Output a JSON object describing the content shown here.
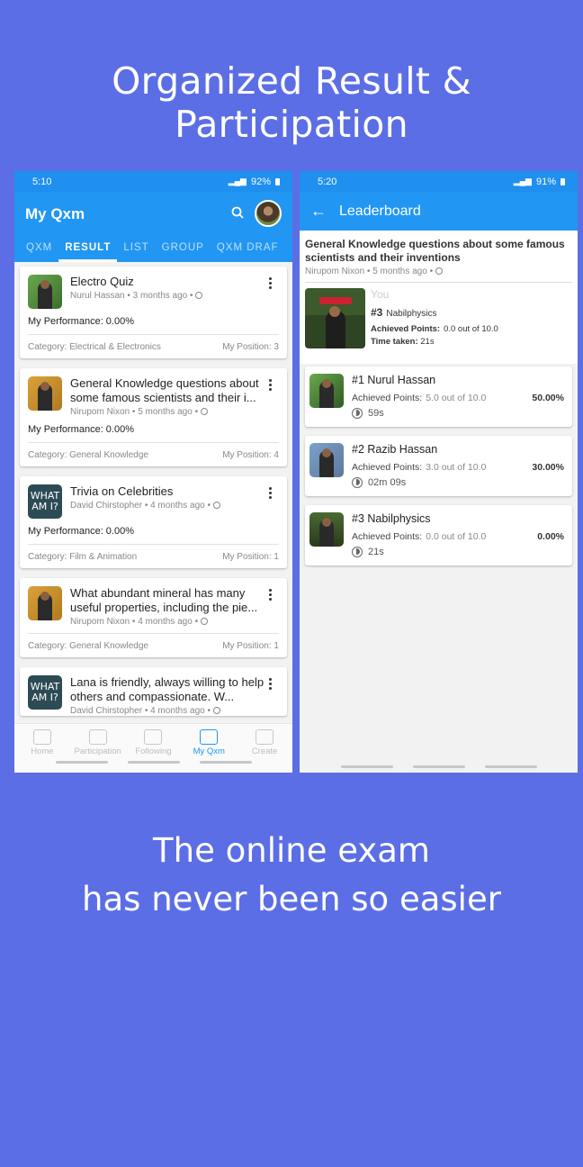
{
  "headline": "Organized Result & Participation",
  "tagline": [
    "The online exam",
    "has never been so easier"
  ],
  "left": {
    "status": {
      "time": "5:10",
      "battery": "92%"
    },
    "title": "My Qxm",
    "tabs": [
      "QXM",
      "RESULT",
      "LIST",
      "GROUP",
      "QXM DRAF"
    ],
    "cards": [
      {
        "title": "Electro Quiz",
        "meta": "Nurul Hassan • 3 months ago •",
        "perf": "My Performance: 0.00%",
        "category": "Category: Electrical & Electronics",
        "position": "My Position: 3"
      },
      {
        "title": "General Knowledge questions about some famous scientists and their i...",
        "meta": "Nirupom Nixon • 5 months ago •",
        "perf": "My Performance: 0.00%",
        "category": "Category: General Knowledge",
        "position": "My Position: 4"
      },
      {
        "title": "Trivia on Celebrities",
        "meta": "David Chirstopher • 4 months ago •",
        "perf": "My Performance: 0.00%",
        "category": "Category: Film & Animation",
        "position": "My Position: 1"
      },
      {
        "title": "What abundant mineral has many useful properties, including the pie...",
        "meta": "Nirupom Nixon • 4 months ago •",
        "category": "Category: General Knowledge",
        "position": "My Position: 1"
      },
      {
        "title": "Lana is friendly, always willing to help others and compassionate. W...",
        "meta": "David Chirstopher • 4 months ago •"
      }
    ],
    "thumb_text": "WHAT AM I?",
    "nav": [
      "Home",
      "Participation",
      "Following",
      "My Qxm",
      "Create"
    ]
  },
  "right": {
    "status": {
      "time": "5:20",
      "battery": "91%"
    },
    "title": "Leaderboard",
    "quiz_title": "General Knowledge questions about some famous scientists and their inventions",
    "quiz_meta": "Nirupom Nixon • 5 months ago •",
    "you": {
      "label": "You",
      "rank": "#3",
      "name": "Nabilphysics",
      "points_label": "Achieved Points:",
      "points": "0.0 out of 10.0",
      "time_label": "Time taken:",
      "time": "21s"
    },
    "entries": [
      {
        "name": "#1 Nurul Hassan",
        "label": "Achieved Points:",
        "points": "5.0 out of 10.0",
        "pct": "50.00%",
        "time": "59s"
      },
      {
        "name": "#2 Razib Hassan",
        "label": "Achieved Points:",
        "points": "3.0 out of 10.0",
        "pct": "30.00%",
        "time": "02m 09s"
      },
      {
        "name": "#3 Nabilphysics",
        "label": "Achieved Points:",
        "points": "0.0 out of 10.0",
        "pct": "0.00%",
        "time": "21s"
      }
    ]
  }
}
